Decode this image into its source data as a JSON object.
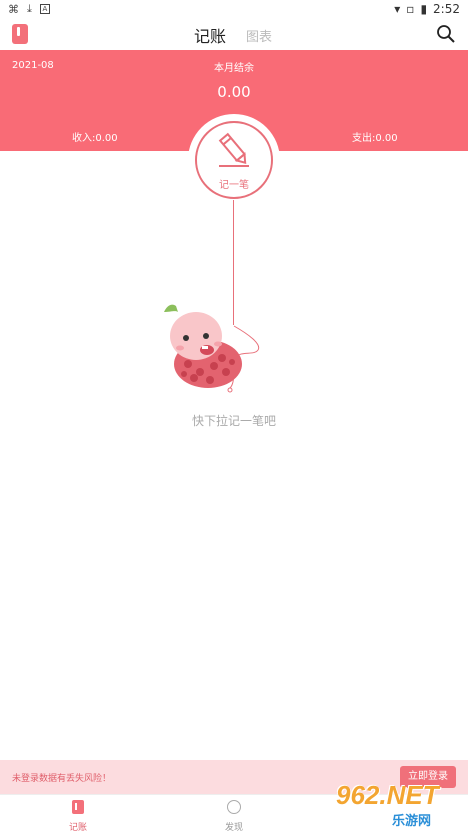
{
  "status_bar": {
    "time": "2:52",
    "left_icons": [
      "bug-icon",
      "download-icon",
      "a-icon"
    ],
    "right_icons": [
      "wifi-icon",
      "no-sim-icon",
      "battery-icon"
    ]
  },
  "header": {
    "tab_active": "记账",
    "tab_inactive": "图表",
    "left_icon": "book-icon",
    "right_icon": "search-icon"
  },
  "summary": {
    "month": "2021-08",
    "balance_label": "本月结余",
    "balance_value": "0.00",
    "income": "收入:0.00",
    "expense": "支出:0.00"
  },
  "note_button": {
    "label": "记一笔",
    "icon": "pencil-icon"
  },
  "empty_hint": "快下拉记一笔吧",
  "login_bar": {
    "message": "未登录数据有丢失风险！",
    "button": "立即登录"
  },
  "bottom_nav": [
    {
      "label": "记账",
      "icon": "ledger-icon",
      "active": true
    },
    {
      "label": "发现",
      "icon": "discover-icon",
      "active": false
    }
  ],
  "watermark": {
    "top": "962.NET",
    "bottom": "乐游网"
  },
  "colors": {
    "accent": "#f96b76",
    "light_accent": "#fcdcdf"
  }
}
